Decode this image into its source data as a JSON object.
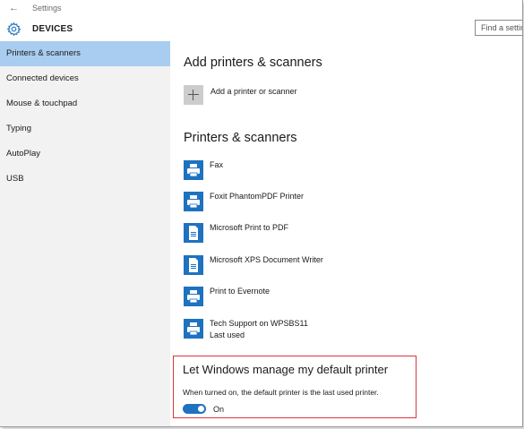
{
  "window": {
    "title": "Settings"
  },
  "header": {
    "title": "DEVICES",
    "search_placeholder": "Find a setting"
  },
  "sidebar": {
    "items": [
      {
        "label": "Printers & scanners",
        "selected": true
      },
      {
        "label": "Connected devices"
      },
      {
        "label": "Mouse & touchpad"
      },
      {
        "label": "Typing"
      },
      {
        "label": "AutoPlay"
      },
      {
        "label": "USB"
      }
    ]
  },
  "main": {
    "add_section_title": "Add printers & scanners",
    "add_label": "Add a printer or scanner",
    "printers_section_title": "Printers & scanners",
    "printers": [
      {
        "name": "Fax",
        "icon": "printer-icon"
      },
      {
        "name": "Foxit PhantomPDF Printer",
        "icon": "printer-icon"
      },
      {
        "name": "Microsoft Print to PDF",
        "icon": "document-printer-icon"
      },
      {
        "name": "Microsoft XPS Document Writer",
        "icon": "document-printer-icon"
      },
      {
        "name": "Print to Evernote",
        "icon": "printer-icon"
      },
      {
        "name": "Tech Support on WPSBS11",
        "status": "Last used",
        "icon": "printer-icon"
      }
    ],
    "default_printer": {
      "title": "Let Windows manage my default printer",
      "description": "When turned on, the default printer is the last used printer.",
      "toggle_state": "On"
    }
  },
  "colors": {
    "accent": "#1e72bf",
    "selected_nav": "#a9cdf0",
    "highlight_border": "#d9363e"
  }
}
